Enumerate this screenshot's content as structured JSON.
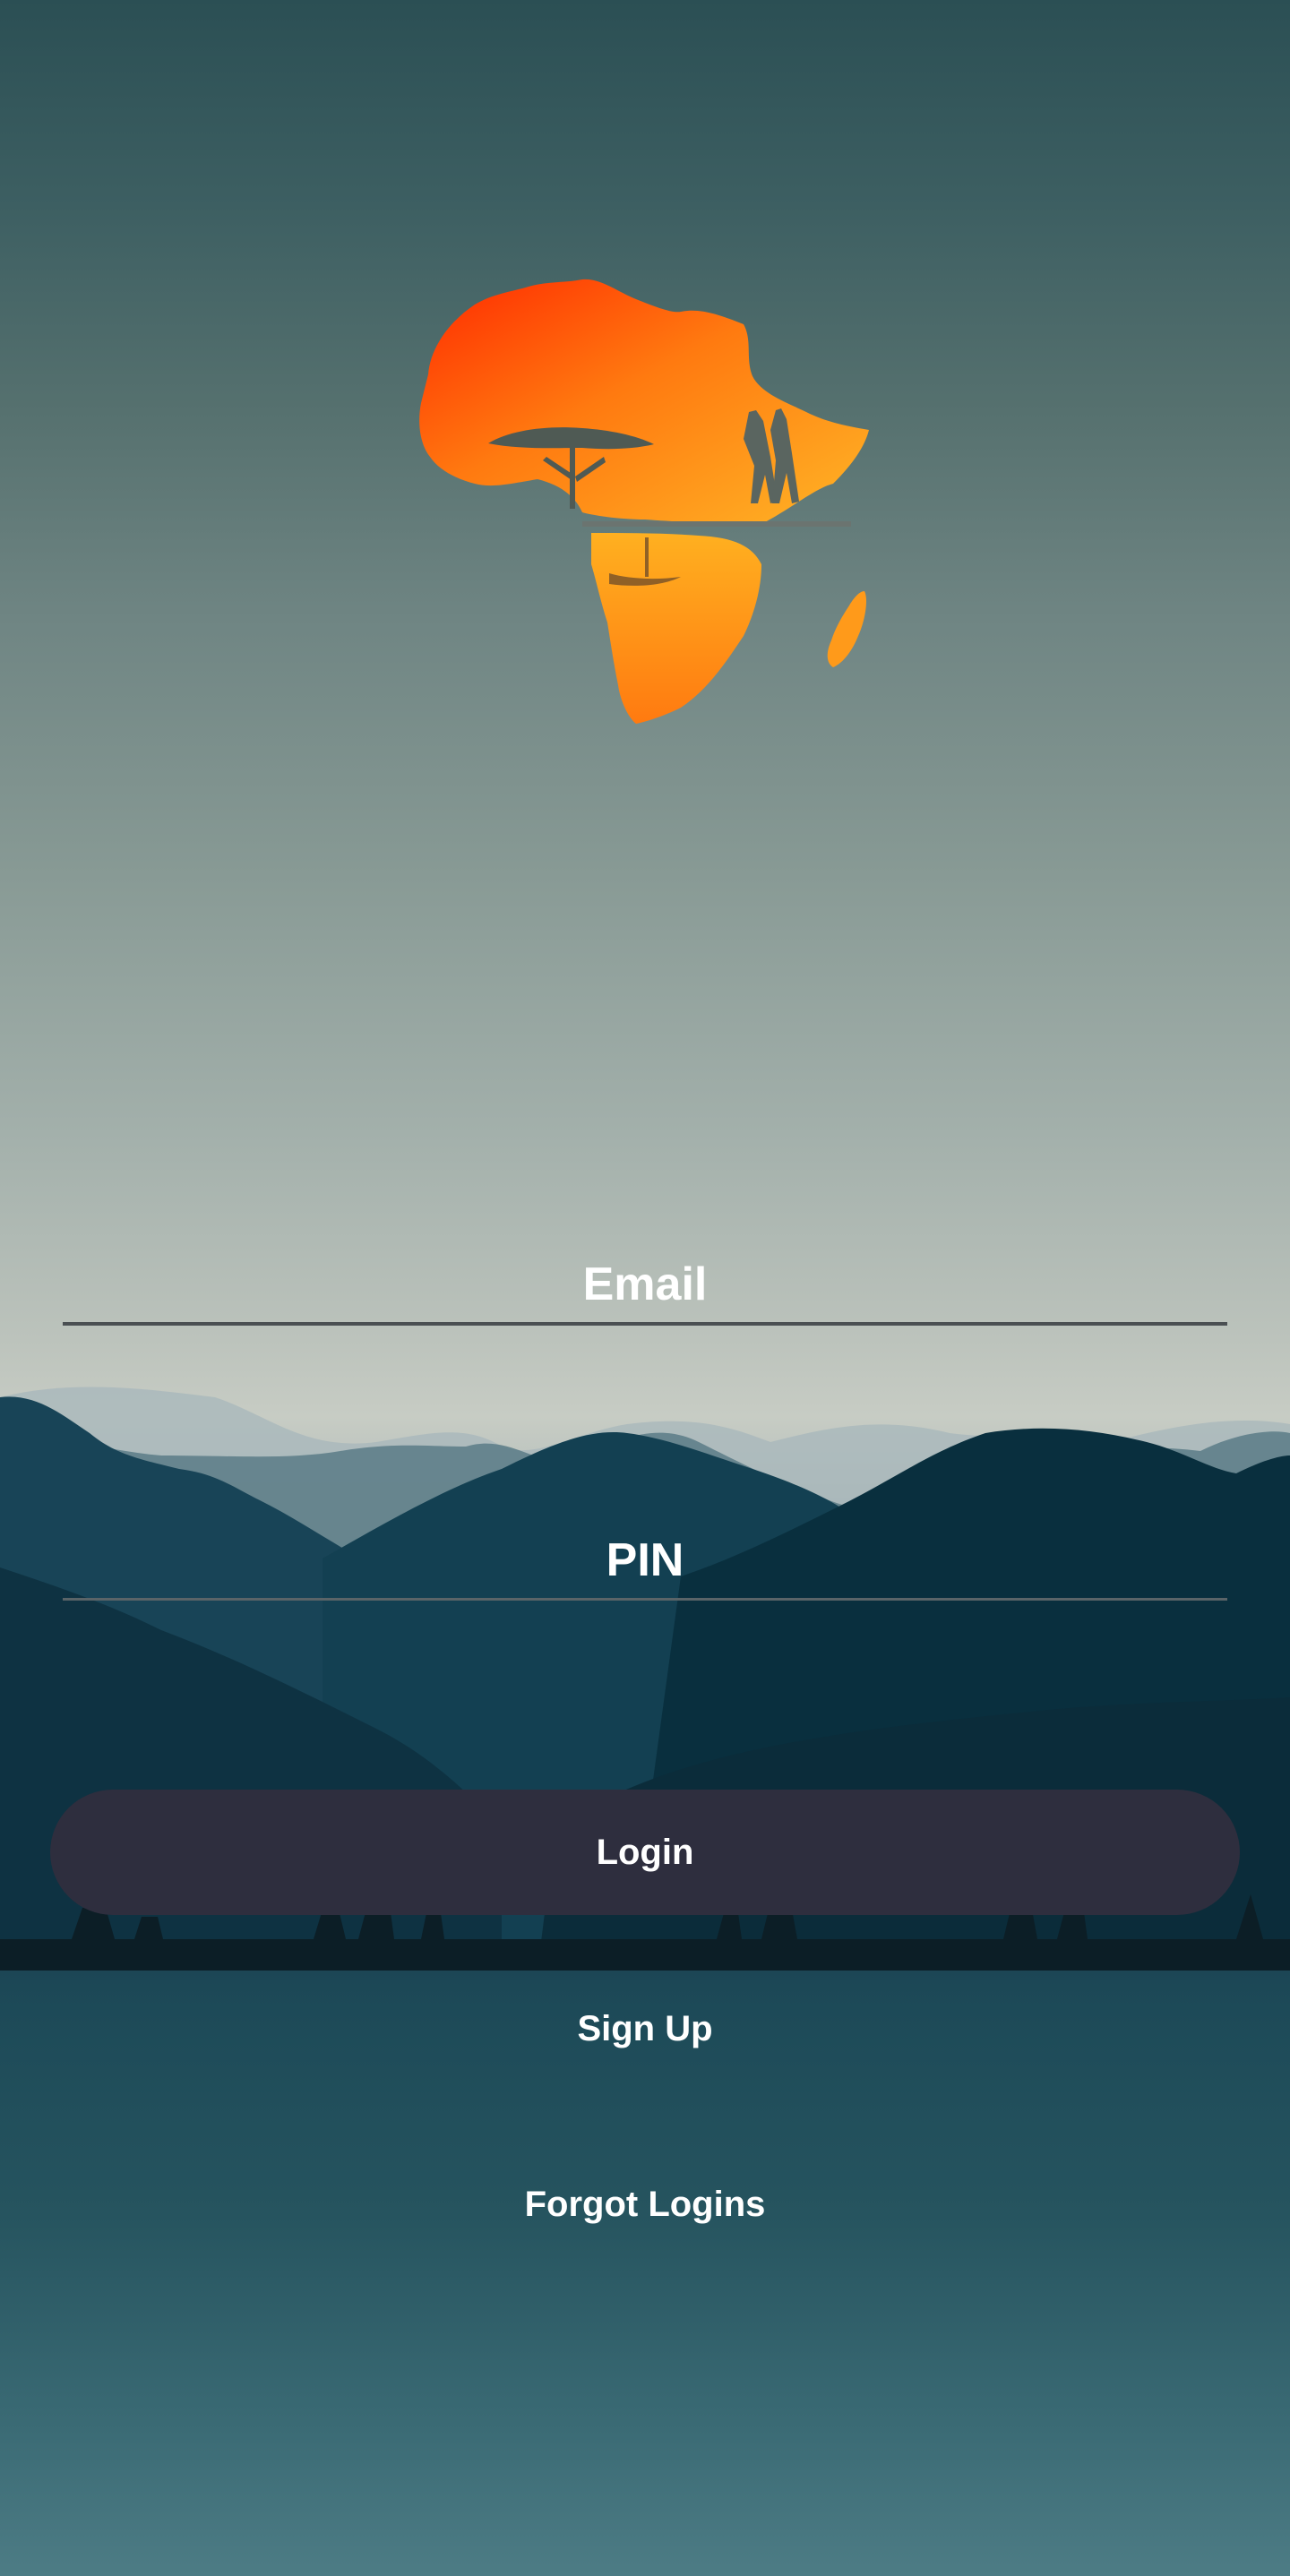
{
  "logo": {
    "icon": "africa-sunset-silhouette-icon",
    "colors": {
      "top": "#ff3b00",
      "middle": "#ff8c1a",
      "bottom": "#ffb020"
    }
  },
  "form": {
    "email_placeholder": "Email",
    "pin_placeholder": "PIN",
    "login_label": "Login",
    "signup_label": "Sign Up",
    "forgot_label": "Forgot Logins"
  },
  "theme": {
    "button_bg": "#2e2e3e",
    "text": "#ffffff"
  }
}
